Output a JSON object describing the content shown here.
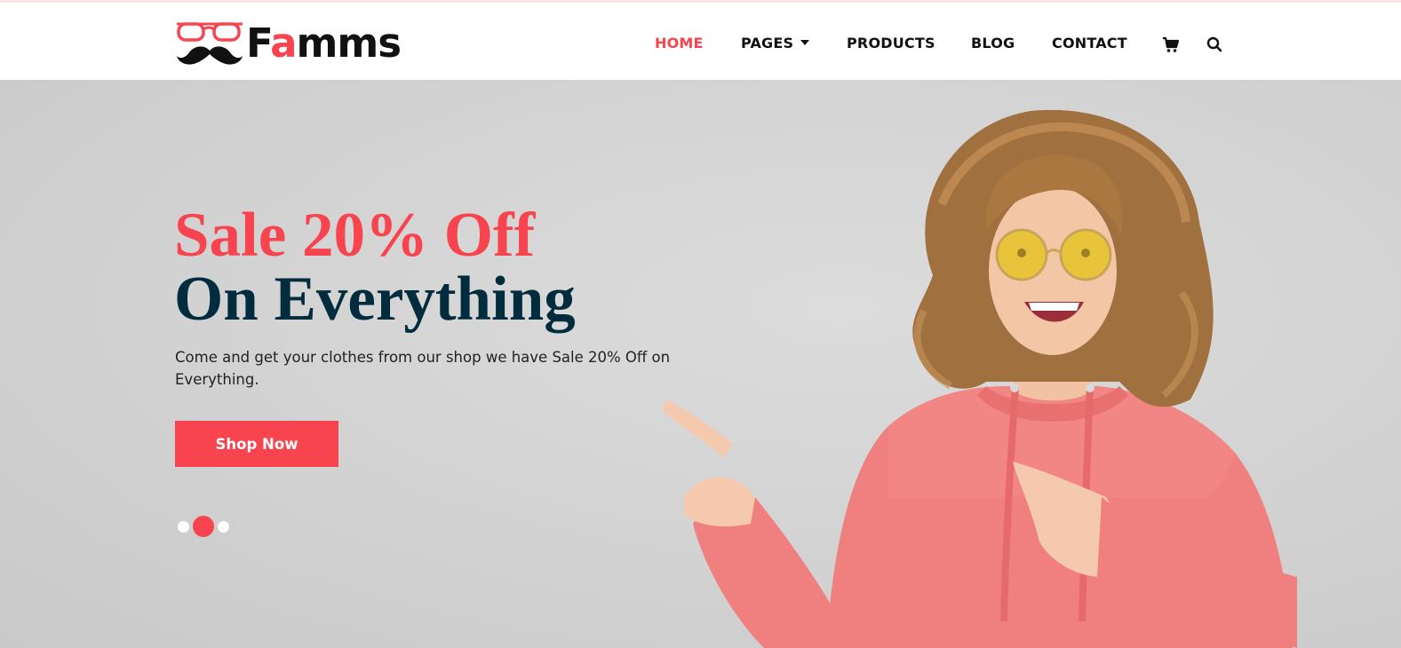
{
  "brand": {
    "name_prefix": "F",
    "name_accent": "a",
    "name_suffix": "mms",
    "accent_color": "#f7444e",
    "dark_color": "#002c3e"
  },
  "nav": {
    "items": [
      {
        "label": "HOME",
        "active": true
      },
      {
        "label": "PAGES",
        "has_dropdown": true
      },
      {
        "label": "PRODUCTS"
      },
      {
        "label": "BLOG"
      },
      {
        "label": "CONTACT"
      }
    ],
    "icons": [
      "cart-icon",
      "search-icon"
    ]
  },
  "hero": {
    "headline_line1": "Sale 20% Off",
    "headline_line2": "On Everything",
    "description": "Come and get your clothes from our shop we have Sale 20% Off on Everything.",
    "cta_label": "Shop Now",
    "slides_total": 3,
    "active_slide": 2
  }
}
